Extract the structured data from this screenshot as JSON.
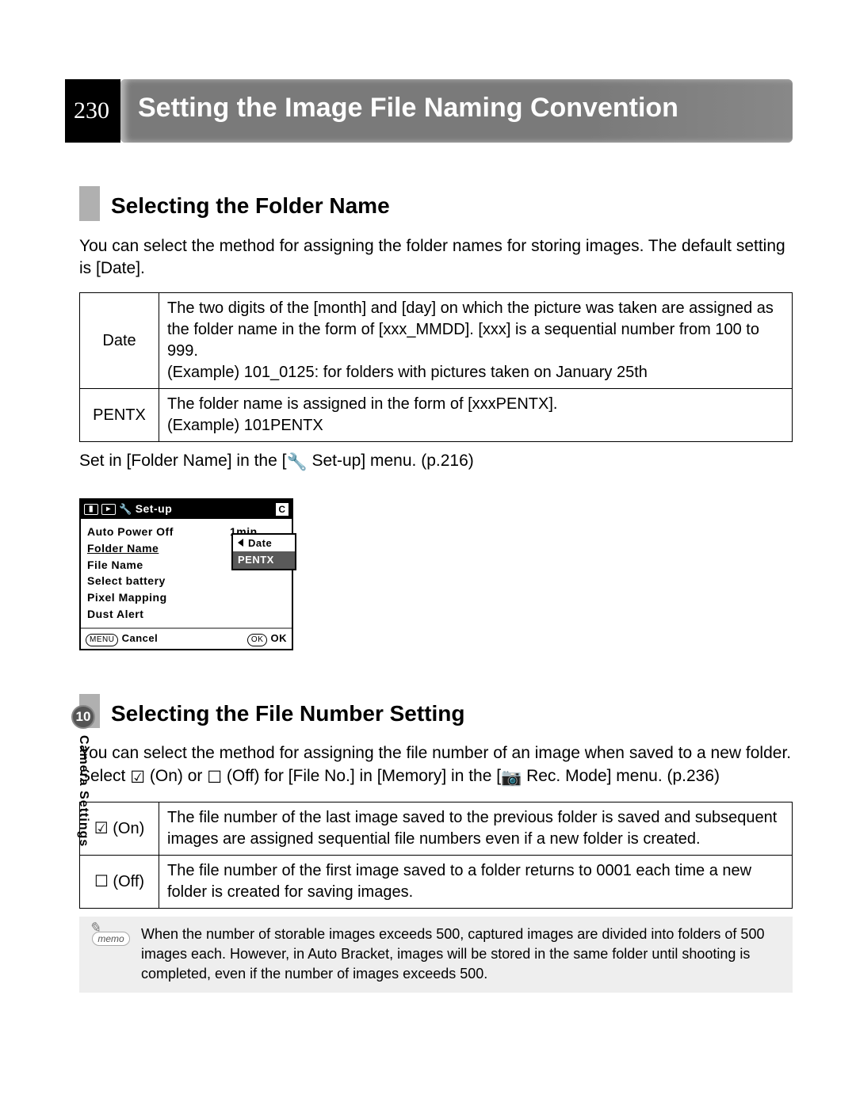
{
  "page_number": "230",
  "title": "Setting the Image File Naming Convention",
  "section1": {
    "heading": "Selecting the Folder Name",
    "intro": "You can select the method for assigning the folder names for storing images. The default setting is [Date].",
    "table": [
      {
        "label": "Date",
        "desc": "The two digits of the [month] and [day] on which the picture was taken are assigned as the folder name in the form of [xxx_MMDD]. [xxx] is a sequential number from 100 to 999.\n(Example) 101_0125: for folders with pictures taken on January 25th"
      },
      {
        "label": "PENTX",
        "desc": "The folder name is assigned in the form of [xxxPENTX].\n(Example) 101PENTX"
      }
    ],
    "set_in_pre": "Set in [Folder Name] in the [",
    "set_in_post": " Set-up] menu. (p.216)"
  },
  "screen": {
    "title": "Set-up",
    "tab_c": "C",
    "items": [
      {
        "label": "Auto Power Off",
        "value": "1min"
      },
      {
        "label": "Folder Name",
        "value": "Date"
      },
      {
        "label": "File Name",
        "value": ""
      },
      {
        "label": "Select battery",
        "value": ""
      },
      {
        "label": "Pixel Mapping",
        "value": ""
      },
      {
        "label": "Dust Alert",
        "value": ""
      }
    ],
    "dropdown": {
      "opt1": "Date",
      "opt2": "PENTX"
    },
    "foot": {
      "menu": "MENU",
      "cancel": "Cancel",
      "ok_btn": "OK",
      "ok": "OK"
    }
  },
  "section2": {
    "heading": "Selecting the File Number Setting",
    "intro_pre": "You can select the method for assigning the file number of an image when saved to a new folder. Select ",
    "intro_mid1": " (On) or ",
    "intro_mid2": " (Off) for [File No.] in [Memory] in the [",
    "intro_post": " Rec. Mode] menu. (p.236)",
    "table": [
      {
        "label": " (On)",
        "desc": "The file number of the last image saved to the previous folder is saved and subsequent images are assigned sequential file numbers even if a new folder is created."
      },
      {
        "label": " (Off)",
        "desc": "The file number of the first image saved to a folder returns to 0001 each time a new folder is created for saving images."
      }
    ]
  },
  "memo": {
    "label": "memo",
    "text": "When the number of storable images exceeds 500, captured images are divided into folders of 500 images each. However, in Auto Bracket, images will be stored in the same folder until shooting is completed, even if the number of images exceeds 500."
  },
  "side": {
    "chapter": "10",
    "label": "Camera Settings"
  }
}
